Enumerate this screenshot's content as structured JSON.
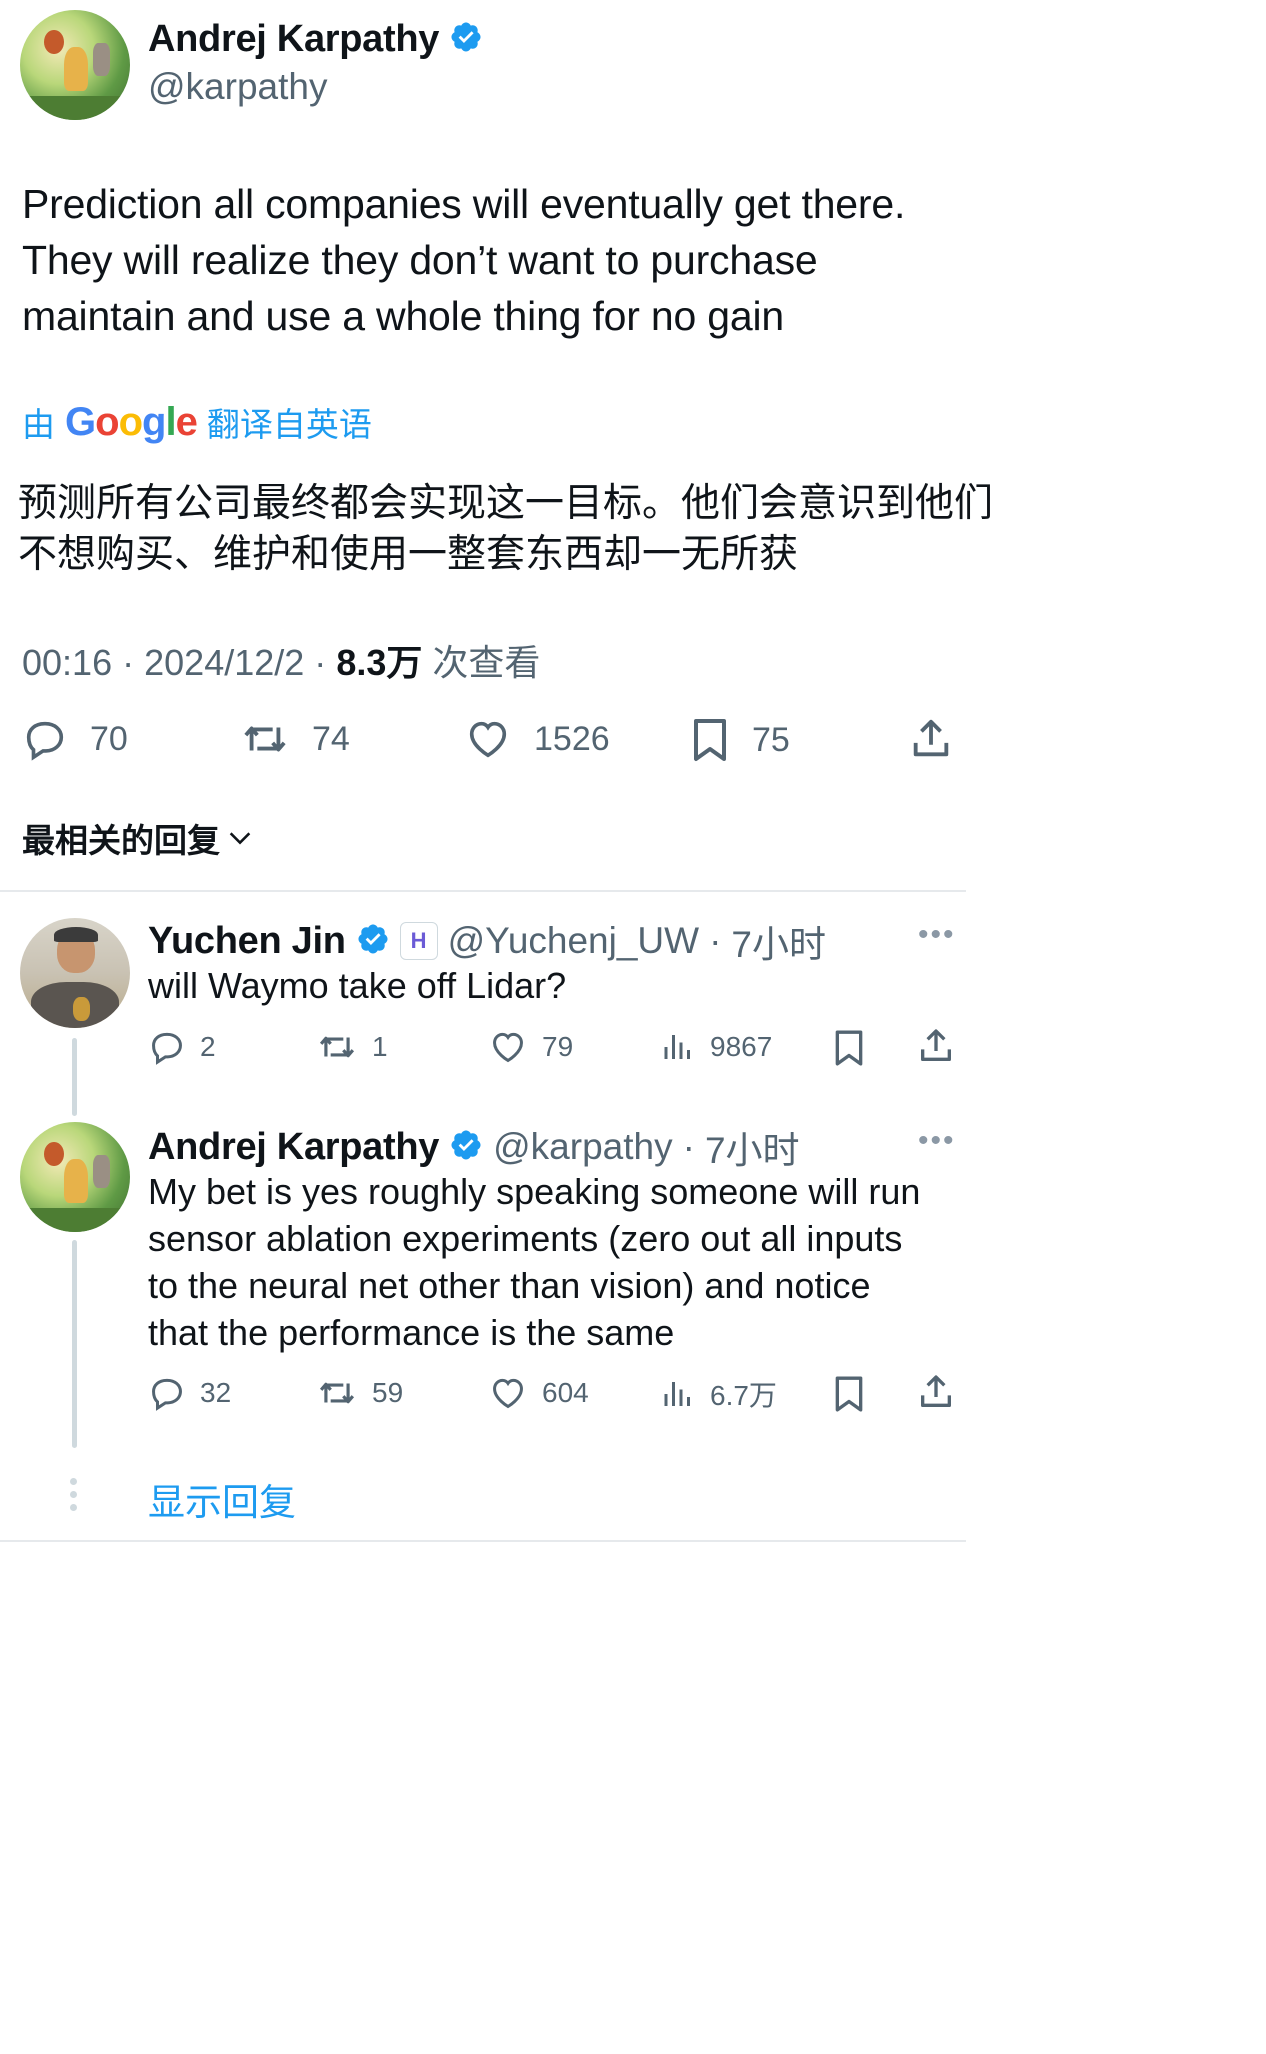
{
  "tweet": {
    "author_name": "Andrej Karpathy",
    "author_handle": "@karpathy",
    "text_line1": "Prediction all companies will eventually get there.",
    "text_line2": "They will realize they don’t want to purchase",
    "text_line3": "maintain and use a whole thing for no gain",
    "translate_prefix": "由",
    "translate_brand": "Google",
    "translate_suffix": "翻译自英语",
    "translation_line1": "预测所有公司最终都会实现这一目标。他们会意识到他们",
    "translation_line2": "不想购买、维护和使用一整套东西却一无所获",
    "time": "00:16",
    "date": "2024/12/2",
    "views_count": "8.3万",
    "views_label": "次查看",
    "separator": "·",
    "stats": {
      "replies": "70",
      "retweets": "74",
      "likes": "1526",
      "bookmarks": "75"
    }
  },
  "sort_label": "最相关的回复",
  "replies": [
    {
      "author_name": "Yuchen Jin",
      "badge": "H",
      "author_handle": "@Yuchenj_UW",
      "time": "7小时",
      "text": "will Waymo take off Lidar?",
      "stats": {
        "replies": "2",
        "retweets": "1",
        "likes": "79",
        "views": "9867"
      }
    },
    {
      "author_name": "Andrej Karpathy",
      "author_handle": "@karpathy",
      "time": "7小时",
      "text_line1": "My bet is yes roughly speaking someone will run",
      "text_line2": "sensor ablation experiments (zero out all inputs",
      "text_line3": "to the neural net other than vision) and notice",
      "text_line4": "that the performance is the same",
      "stats": {
        "replies": "32",
        "retweets": "59",
        "likes": "604",
        "views": "6.7万"
      }
    }
  ],
  "show_replies_label": "显示回复",
  "colors": {
    "link_blue": "#1d9bf0",
    "text_primary": "#0f1419",
    "text_secondary": "#536471",
    "verified_blue": "#1d9bf0"
  },
  "icons": [
    "verified-badge-icon",
    "reply-icon",
    "retweet-icon",
    "like-icon",
    "bookmark-icon",
    "share-icon",
    "views-icon",
    "more-icon",
    "chevron-down-icon"
  ]
}
